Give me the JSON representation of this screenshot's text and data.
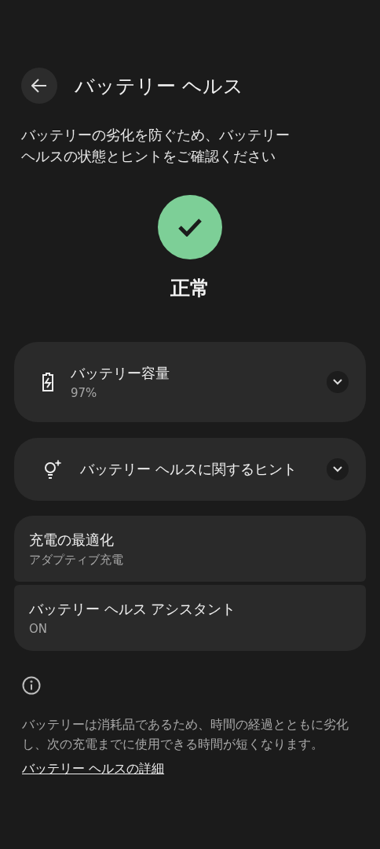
{
  "header": {
    "title": "バッテリー ヘルス"
  },
  "description": "バッテリーの劣化を防ぐため、バッテリーヘルスの状態とヒントをご確認ください",
  "status": {
    "label": "正常",
    "kind": "ok"
  },
  "cards": [
    {
      "kind": "battery",
      "title": "バッテリー容量",
      "subtitle": "97%",
      "expanded": false
    },
    {
      "kind": "tips",
      "title": "バッテリー ヘルスに関するヒント",
      "expanded": false
    }
  ],
  "settings": [
    {
      "title": "充電の最適化",
      "subtitle": "アダプティブ充電"
    },
    {
      "title": "バッテリー ヘルス アシスタント",
      "subtitle": "ON"
    }
  ],
  "footer": {
    "text": "バッテリーは消耗品であるため、時間の経過とともに劣化し、次の充電までに使用できる時間が短くなります。",
    "link": "バッテリー ヘルスの詳細"
  }
}
